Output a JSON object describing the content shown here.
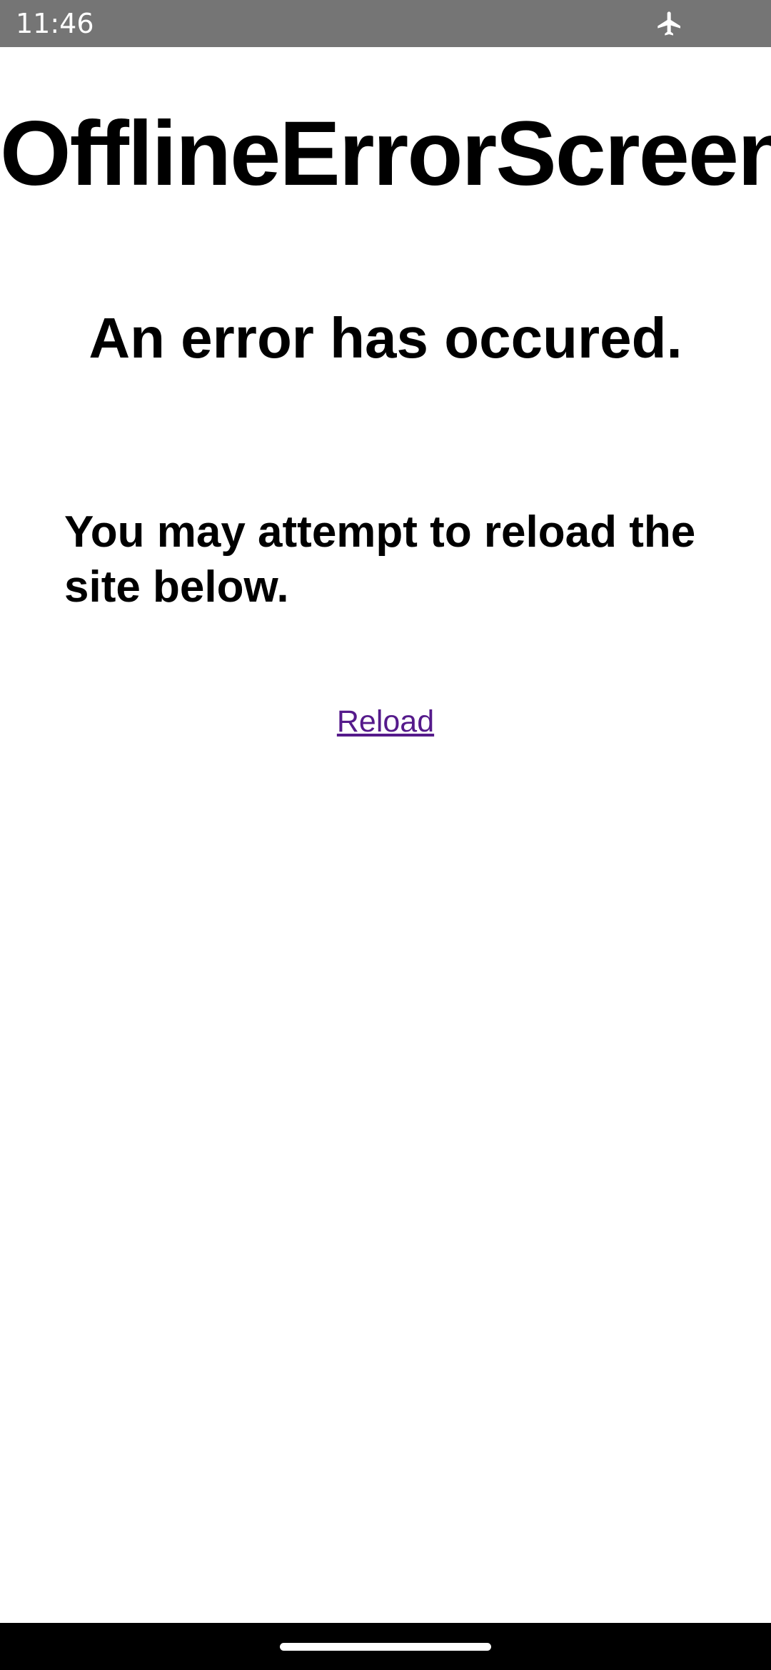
{
  "status_bar": {
    "time": "11:46",
    "icons": [
      "airplane-mode-icon"
    ],
    "background_color": "#757575"
  },
  "page": {
    "title": "OfflineErrorScreen",
    "error_heading": "An error has occured.",
    "error_message": "You may attempt to reload the site below.",
    "reload_link": "Reload",
    "link_color": "#551a8b"
  },
  "navigation_bar": {
    "type": "gesture-navigation",
    "background_color": "#000000"
  }
}
